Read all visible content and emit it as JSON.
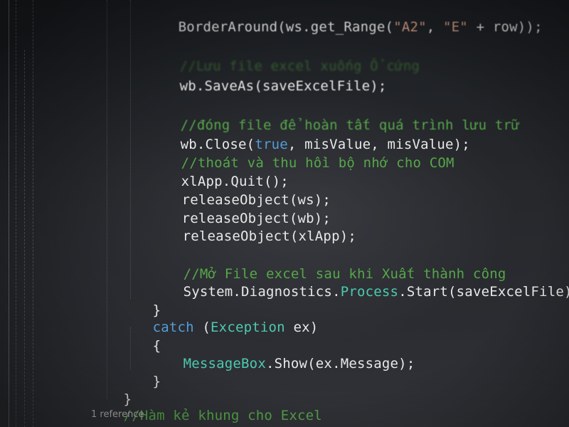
{
  "editor": {
    "theme_colors": {
      "background": "#1e1e1e",
      "comment": "#57a64a",
      "keyword": "#569cd6",
      "type": "#4ec9b0",
      "string": "#d69d85",
      "text": "#e8e8e8"
    },
    "lines": {
      "l1": {
        "a": "BorderAround(ws.get_Range(",
        "b": "\"A2\"",
        "c": ", ",
        "d": "\"E\"",
        "e": " + row));"
      },
      "l2": {
        "comment": "//Lưu file excel xuống Ổ cứng"
      },
      "l3": {
        "a": "wb.SaveAs(saveExcelFile);"
      },
      "l4": {
        "comment": "//đóng file để hoàn tất quá trình lưu trữ"
      },
      "l5": {
        "a": "wb.Close(",
        "kw": "true",
        "b": ", misValue, misValue);"
      },
      "l6": {
        "comment": "//thoát và thu hồi bộ nhớ cho COM"
      },
      "l7": {
        "a": "xlApp.Quit();"
      },
      "l8": {
        "a": "releaseObject(ws);"
      },
      "l9": {
        "a": "releaseObject(wb);"
      },
      "l10": {
        "a": "releaseObject(xlApp);"
      },
      "l11": {
        "comment": "//Mở File excel sau khi Xuất thành công"
      },
      "l12": {
        "a": "System.Diagnostics.",
        "type": "Process",
        "b": ".Start(saveExcelFile);"
      },
      "l13": {
        "a": "}"
      },
      "l14": {
        "kw": "catch",
        "b": " (",
        "type": "Exception",
        "c": " ex)"
      },
      "l15": {
        "a": "{"
      },
      "l16": {
        "type": "MessageBox",
        "b": ".Show(ex.Message);"
      },
      "l17": {
        "a": "}"
      },
      "l18": {
        "a": "}"
      },
      "l19": {
        "comment": "//Hàm kẻ khung cho Excel"
      },
      "codelens": "1 reference"
    }
  }
}
